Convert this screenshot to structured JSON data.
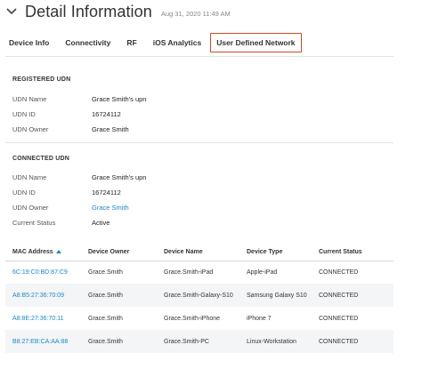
{
  "header": {
    "title": "Detail Information",
    "timestamp": "Aug 31, 2020 11:49 AM"
  },
  "tabs": [
    {
      "label": "Device Info"
    },
    {
      "label": "Connectivity"
    },
    {
      "label": "RF"
    },
    {
      "label": "iOS Analytics"
    },
    {
      "label": "User Defined Network",
      "active": true
    }
  ],
  "registered": {
    "title": "REGISTERED UDN",
    "rows": [
      {
        "label": "UDN Name",
        "value": "Grace Smith's upn"
      },
      {
        "label": "UDN ID",
        "value": "16724112"
      },
      {
        "label": "UDN Owner",
        "value": "Grace Smith"
      }
    ]
  },
  "connected": {
    "title": "CONNECTED UDN",
    "rows": [
      {
        "label": "UDN Name",
        "value": "Grace Smith's upn"
      },
      {
        "label": "UDN ID",
        "value": "16724112"
      },
      {
        "label": "UDN Owner",
        "value": "Grace Smith"
      },
      {
        "label": "Current Status",
        "value": "Active"
      }
    ]
  },
  "table": {
    "columns": [
      "MAC Address",
      "Device Owner",
      "Device Name",
      "Device Type",
      "Current Status"
    ],
    "rows": [
      [
        "6C:19:C0:BD:87:C9",
        "Grace.Smith",
        "Grace.Smith-iPad",
        "Apple-iPad",
        "CONNECTED"
      ],
      [
        "A8:B5:27:36:70:09",
        "Grace.Smith",
        "Grace.Smith-Galaxy-S10",
        "Samsung Galaxy S10",
        "CONNECTED"
      ],
      [
        "A8:8E:27:36:70:11",
        "Grace.Smith",
        "Grace.Smith-iPhone",
        "iPhone 7",
        "CONNECTED"
      ],
      [
        "B8:27:EB:CA:AA:88",
        "Grace.Smith",
        "Grace.Smith-PC",
        "Linux-Workstation",
        "CONNECTED"
      ]
    ]
  },
  "colors": {
    "link": "#1a88c9",
    "active_tab_border": "#d04a27"
  },
  "icons": {
    "collapse": "chevron-down-icon",
    "sort": "sort-ascending-icon"
  }
}
